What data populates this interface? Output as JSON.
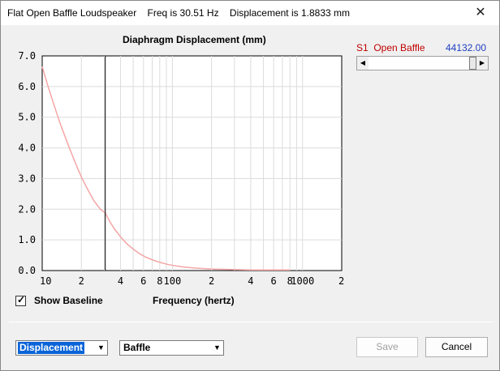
{
  "window": {
    "title": "Flat Open Baffle Loudspeaker    Freq is 30.51 Hz    Displacement is 1.8833 mm",
    "close_glyph": "✕"
  },
  "chart_data": {
    "type": "line",
    "title": "Diaphragm Displacement (mm)",
    "xlabel": "Frequency (hertz)",
    "ylabel": "",
    "xscale": "log",
    "xlim": [
      10,
      2000
    ],
    "ylim": [
      0,
      7.0
    ],
    "y_ticks": [
      "7.0",
      "6.0",
      "5.0",
      "4.0",
      "3.0",
      "2.0",
      "1.0",
      "0.0"
    ],
    "x_ticks": [
      "10",
      "2",
      "4",
      "6",
      "8",
      "100",
      "2",
      "4",
      "6",
      "8",
      "1000",
      "2"
    ],
    "grid": true,
    "cursor_x": 30.51,
    "series": [
      {
        "name": "S1  Open Baffle",
        "color": "#f4a6a6",
        "x": [
          10,
          11,
          12,
          13,
          14,
          16,
          18,
          20,
          22,
          25,
          28,
          30.51,
          33,
          36,
          40,
          45,
          50,
          56,
          63,
          70,
          80,
          90,
          100,
          120,
          150,
          200,
          250,
          300,
          400,
          500,
          600,
          700,
          800
        ],
        "y": [
          6.65,
          6.05,
          5.55,
          5.1,
          4.7,
          4.05,
          3.5,
          3.05,
          2.7,
          2.27,
          2.0,
          1.88,
          1.6,
          1.35,
          1.1,
          0.86,
          0.7,
          0.55,
          0.43,
          0.35,
          0.27,
          0.21,
          0.17,
          0.12,
          0.08,
          0.05,
          0.04,
          0.03,
          0.02,
          0.02,
          0.02,
          0.02,
          0.02
        ]
      }
    ]
  },
  "legend": {
    "series_label": "S1  Open Baffle",
    "series_value": "44132.00"
  },
  "controls": {
    "show_baseline_label": "Show Baseline",
    "show_baseline_checked": true,
    "check_glyph": "✓",
    "dropdown1_value": "Displacement",
    "dropdown2_value": "Baffle",
    "dropdown_glyph": "▼",
    "save_label": "Save",
    "cancel_label": "Cancel",
    "scroll_left_glyph": "◀",
    "scroll_right_glyph": "▶"
  }
}
